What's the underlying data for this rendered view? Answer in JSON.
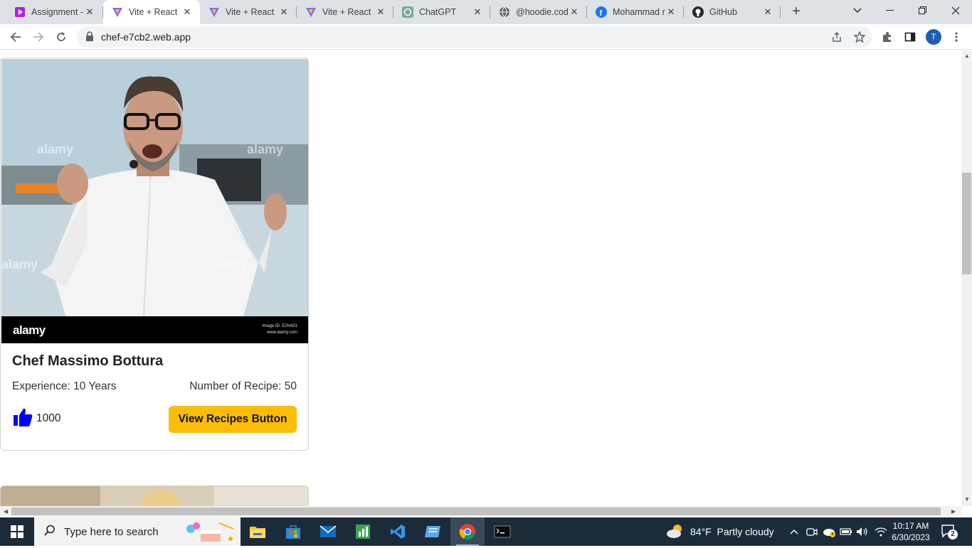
{
  "browser": {
    "tabs": [
      {
        "title": "Assignment -",
        "favicon": "purple-play-icon",
        "active": false
      },
      {
        "title": "Vite + React",
        "favicon": "vite-icon",
        "active": true
      },
      {
        "title": "Vite + React",
        "favicon": "vite-icon",
        "active": false
      },
      {
        "title": "Vite + React",
        "favicon": "vite-icon",
        "active": false
      },
      {
        "title": "ChatGPT",
        "favicon": "chatgpt-icon",
        "active": false
      },
      {
        "title": "@hoodie.cod",
        "favicon": "globe-icon",
        "active": false
      },
      {
        "title": "Mohammad r",
        "favicon": "facebook-icon",
        "active": false
      },
      {
        "title": "GitHub",
        "favicon": "github-icon",
        "active": false
      }
    ],
    "url": "chef-e7cb2.web.app",
    "profile_initial": "T"
  },
  "page": {
    "chef_card": {
      "photo_brand": "alamy",
      "photo_credit_line1": "Image ID: E2N431",
      "photo_credit_line2": "www.alamy.com",
      "name": "Chef Massimo Bottura",
      "experience": "Experience: 10 Years",
      "recipes": "Number of Recipe: 50",
      "likes": "1000",
      "view_button": "View Recipes Button"
    }
  },
  "taskbar": {
    "search_placeholder": "Type here to search",
    "weather": "84°F  Partly cloudy",
    "time": "10:17 AM",
    "date": "6/30/2023",
    "notification_count": "2"
  },
  "colors": {
    "button_yellow": "#fbbd08",
    "like_blue": "#0000ff",
    "taskbar": "#1c2b3a"
  }
}
